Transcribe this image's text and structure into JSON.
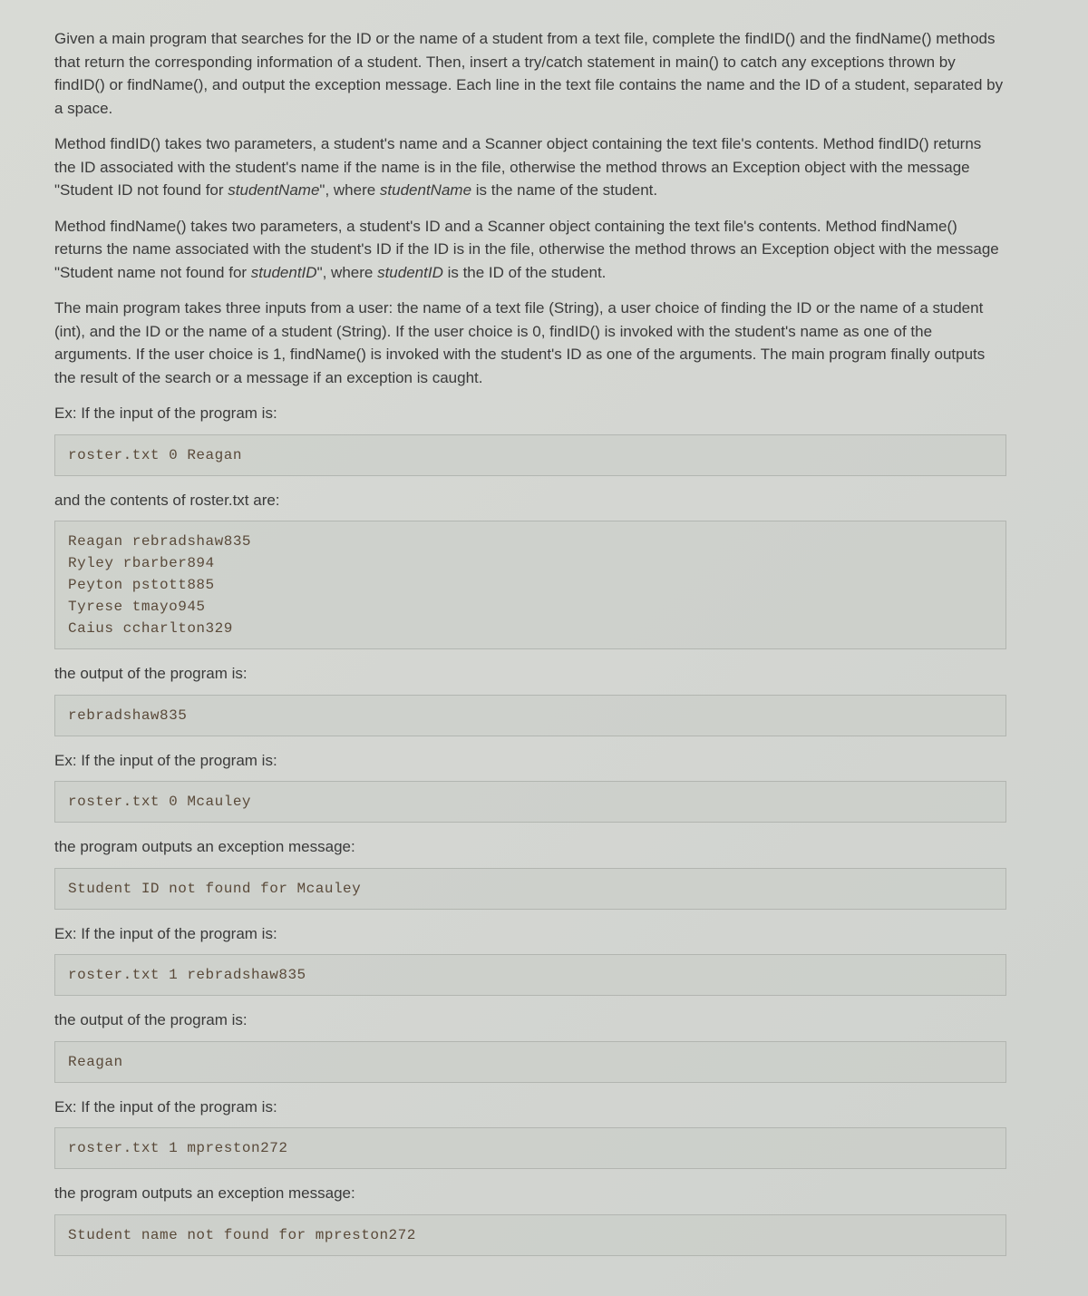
{
  "paragraphs": {
    "intro": "Given a main program that searches for the ID or the name of a student from a text file, complete the findID() and the findName() methods that return the corresponding information of a student. Then, insert a try/catch statement in main() to catch any exceptions thrown by findID() or findName(), and output the exception message. Each line in the text file contains the name and the ID of a student, separated by a space.",
    "findID_para_1": "Method findID() takes two parameters, a student's name and a Scanner object containing the text file's contents. Method findID() returns the ID associated with the student's name if the name is in the file, otherwise the method throws an Exception object with the message \"Student ID not found for ",
    "findID_italic_1": "studentName",
    "findID_para_2": "\", where ",
    "findID_italic_2": "studentName",
    "findID_para_3": " is the name of the student.",
    "findName_para_1": "Method findName() takes two parameters, a student's ID and a Scanner object containing the text file's contents. Method findName() returns the name associated with the student's ID if the ID is in the file, otherwise the method throws an Exception object with the message \"Student name not found for ",
    "findName_italic_1": "studentID",
    "findName_para_2": "\", where ",
    "findName_italic_2": "studentID",
    "findName_para_3": " is the ID of the student.",
    "main_desc": "The main program takes three inputs from a user: the name of a text file (String), a user choice of finding the ID or the name of a student (int), and the ID or the name of a student (String). If the user choice is 0, findID() is invoked with the student's name as one of the arguments. If the user choice is 1, findName() is invoked with the student's ID as one of the arguments. The main program finally outputs the result of the search or a message if an exception is caught.",
    "ex1_label": "Ex: If the input of the program is:",
    "ex1_code": "roster.txt 0 Reagan",
    "roster_label": "and the contents of roster.txt are:",
    "roster_code": "Reagan rebradshaw835\nRyley rbarber894\nPeyton pstott885\nTyrese tmayo945\nCaius ccharlton329",
    "output1_label": "the output of the program is:",
    "output1_code": "rebradshaw835",
    "ex2_label": "Ex: If the input of the program is:",
    "ex2_code": "roster.txt 0 Mcauley",
    "exception1_label": "the program outputs an exception message:",
    "exception1_code": "Student ID not found for Mcauley",
    "ex3_label": "Ex: If the input of the program is:",
    "ex3_code": "roster.txt 1 rebradshaw835",
    "output2_label": "the output of the program is:",
    "output2_code": "Reagan",
    "ex4_label": "Ex: If the input of the program is:",
    "ex4_code": "roster.txt 1 mpreston272",
    "exception2_label": "the program outputs an exception message:",
    "exception2_code": "Student name not found for mpreston272"
  }
}
